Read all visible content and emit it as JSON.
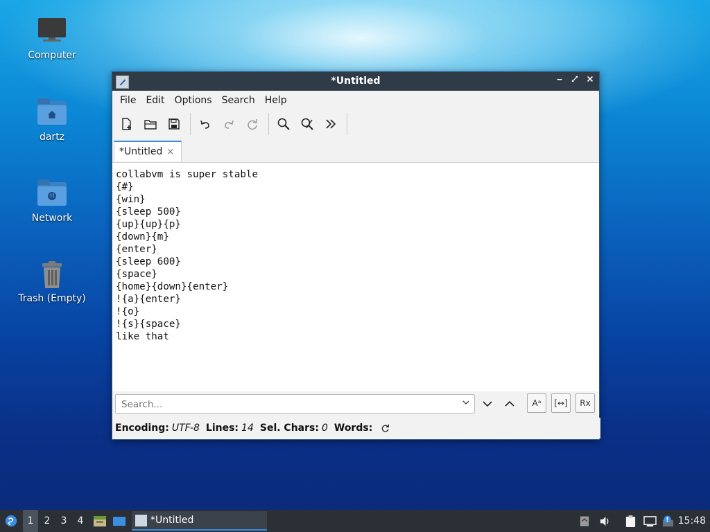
{
  "desktop": {
    "icons": [
      {
        "label": "Computer"
      },
      {
        "label": "dartz"
      },
      {
        "label": "Network"
      },
      {
        "label": "Trash (Empty)"
      }
    ]
  },
  "window": {
    "title": "*Untitled",
    "menu": [
      "File",
      "Edit",
      "Options",
      "Search",
      "Help"
    ],
    "tab": {
      "label": "*Untitled",
      "close": "×"
    },
    "editor_text": "collabvm is super stable\n{#}\n{win}\n{sleep 500}\n{up}{up}{p}\n{down}{m}\n{enter}\n{sleep 600}\n{space}\n{home}{down}{enter}\n!{a}{enter}\n!{o}\n!{s}{space}\nlike that",
    "search": {
      "placeholder": "Search...",
      "value": ""
    },
    "search_options": {
      "match_case": "Aᵃ",
      "whole_word": "[↔]",
      "regex": "Rx"
    },
    "status": {
      "encoding_label": "Encoding:",
      "encoding_value": "UTF-8",
      "lines_label": "Lines:",
      "lines_value": "14",
      "sel_label": "Sel. Chars:",
      "sel_value": "0",
      "words_label": "Words:"
    }
  },
  "taskbar": {
    "workspaces": [
      "1",
      "2",
      "3",
      "4"
    ],
    "active_task": "*Untitled",
    "clock": "15:48"
  },
  "colors": {
    "accent": "#3b8ee0",
    "titlebar": "#2f3b46",
    "taskbar": "#2b3037"
  }
}
